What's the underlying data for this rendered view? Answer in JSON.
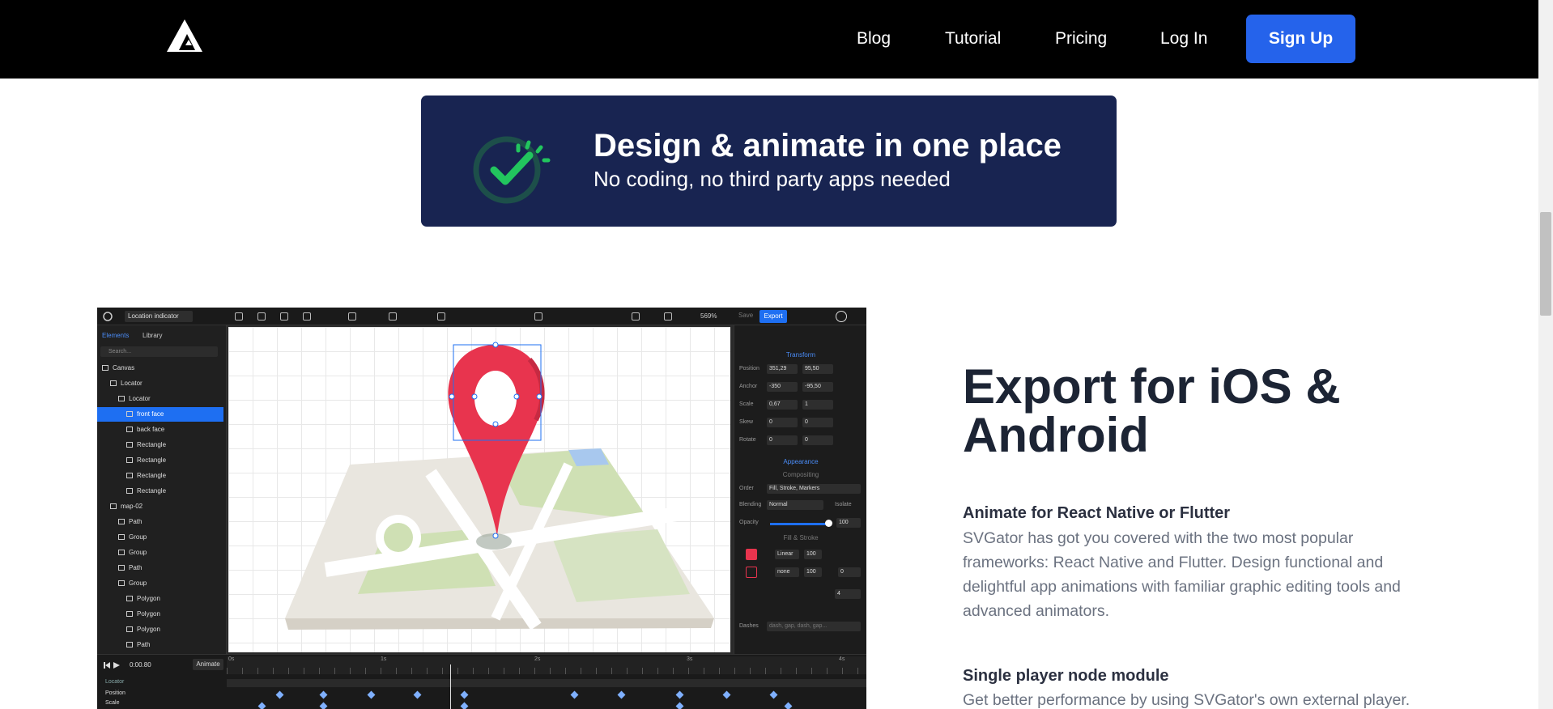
{
  "nav": {
    "links": [
      "Blog",
      "Tutorial",
      "Pricing",
      "Log In"
    ],
    "signup_label": "Sign Up"
  },
  "banner": {
    "title": "Design & animate in one place",
    "subtitle": "No coding, no third party apps needed"
  },
  "editor": {
    "doc_name": "Location indicator",
    "zoom": "569%",
    "save_label": "Save",
    "export_label": "Export",
    "tabs": [
      "Elements",
      "Library"
    ],
    "search_placeholder": "Search...",
    "layers": [
      {
        "label": "Canvas",
        "indent": 0
      },
      {
        "label": "Locator",
        "indent": 1
      },
      {
        "label": "Locator",
        "indent": 2
      },
      {
        "label": "front face",
        "indent": 3,
        "selected": true
      },
      {
        "label": "back face",
        "indent": 3
      },
      {
        "label": "Rectangle",
        "indent": 3
      },
      {
        "label": "Rectangle",
        "indent": 3
      },
      {
        "label": "Rectangle",
        "indent": 3
      },
      {
        "label": "Rectangle",
        "indent": 3
      },
      {
        "label": "map-02",
        "indent": 1
      },
      {
        "label": "Path",
        "indent": 2
      },
      {
        "label": "Group",
        "indent": 2
      },
      {
        "label": "Group",
        "indent": 2
      },
      {
        "label": "Path",
        "indent": 2
      },
      {
        "label": "Group",
        "indent": 2
      },
      {
        "label": "Polygon",
        "indent": 3
      },
      {
        "label": "Polygon",
        "indent": 3
      },
      {
        "label": "Polygon",
        "indent": 3
      },
      {
        "label": "Path",
        "indent": 3
      }
    ],
    "transform": {
      "section": "Transform",
      "position_label": "Position",
      "position_x": "351,29",
      "position_y": "95,50",
      "anchor_label": "Anchor",
      "anchor_x": "-350",
      "anchor_y": "-95,50",
      "scale_label": "Scale",
      "scale_x": "0,67",
      "scale_y": "1",
      "skew_label": "Skew",
      "skew_x": "0",
      "skew_y": "0",
      "rotate_label": "Rotate",
      "rotate_x": "0",
      "rotate_y": "0"
    },
    "appearance": {
      "section": "Appearance",
      "compositing": "Compositing",
      "order_label": "Order",
      "order_value": "Fill, Stroke, Markers",
      "blending_label": "Blending",
      "blending_value": "Normal",
      "isolate_label": "Isolate",
      "opacity_label": "Opacity",
      "opacity_value": "100",
      "fill_stroke": "Fill & Stroke",
      "fill_type": "Linear",
      "fill_opacity": "100",
      "stroke_type": "none",
      "stroke_opacity": "100",
      "stroke_width": "0",
      "miter_value": "4",
      "dashes_label": "Dashes",
      "dashes_placeholder": "dash, gap, dash, gap..."
    },
    "timeline": {
      "time": "0:00.80",
      "animate_label": "Animate",
      "ticks": [
        "0s",
        "1s",
        "2s",
        "3s",
        "4s"
      ],
      "rows": [
        "Locator",
        "Position",
        "Scale"
      ]
    }
  },
  "section": {
    "title": "Export for iOS & Android",
    "features": [
      {
        "title": "Animate for React Native or Flutter",
        "lines": [
          "SVGator has got you covered with the two most popular",
          "frameworks: React Native and Flutter. Design functional and",
          "delightful app animations with familiar graphic editing tools and",
          "advanced animators."
        ]
      },
      {
        "title": "Single player node module",
        "lines": [
          "Get better performance by using SVGator's own external player."
        ]
      }
    ]
  },
  "colors": {
    "nav_bg": "#000000",
    "signup_bg": "#2563eb",
    "banner_bg": "#182451",
    "check_green": "#22c55e",
    "pin_red": "#e8344e",
    "selection_blue": "#1e6ff2"
  },
  "icons": [
    "logo-icon",
    "check-circle-icon",
    "location-pin-icon",
    "avatar-icon",
    "play-icon"
  ]
}
